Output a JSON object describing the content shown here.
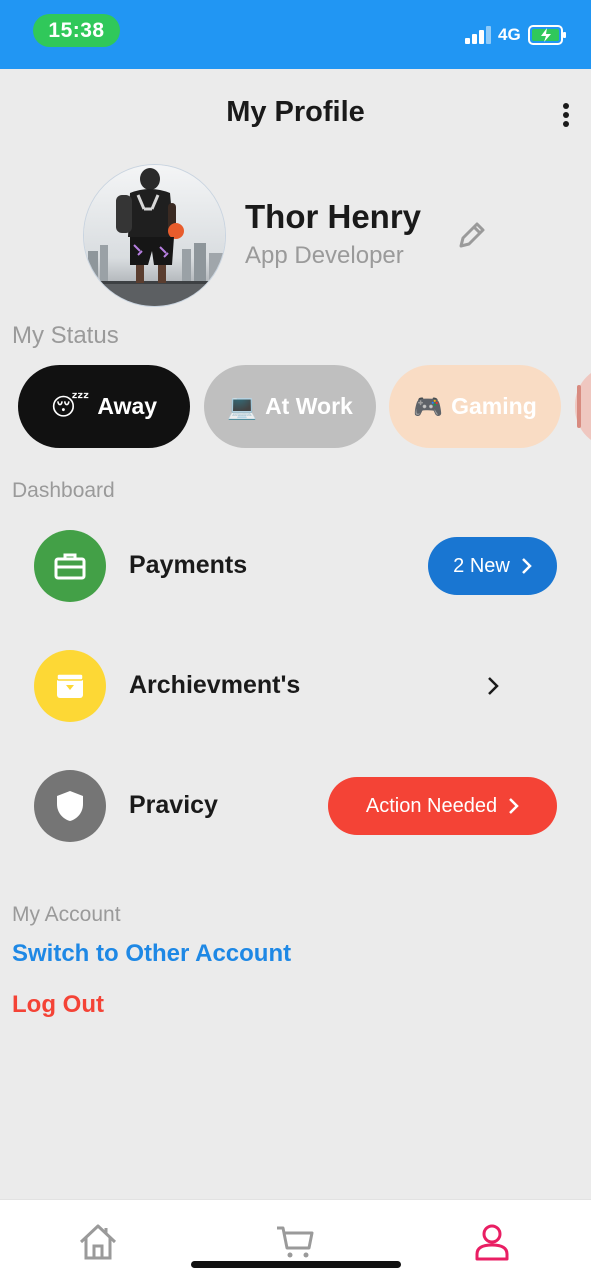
{
  "status_bar": {
    "time": "15:38",
    "network": "4G",
    "bar_color": "#2196f3",
    "time_pill_color": "#30c85a"
  },
  "header": {
    "title": "My Profile",
    "more_icon": "more-vertical-icon"
  },
  "profile": {
    "name": "Thor Henry",
    "role": "App Developer",
    "edit_icon": "pencil-icon"
  },
  "status_section": {
    "label": "My Status",
    "chips": [
      {
        "emoji": "😴",
        "label": "Away",
        "selected": true
      },
      {
        "emoji": "💻",
        "label": "At Work",
        "selected": false
      },
      {
        "emoji": "🎮",
        "label": "Gaming",
        "selected": false
      }
    ]
  },
  "dashboard": {
    "label": "Dashboard",
    "items": [
      {
        "label": "Payments",
        "icon": "briefcase-icon",
        "icon_bg": "#43a047",
        "badge": "2 New",
        "badge_color": "#1976d2"
      },
      {
        "label": "Archievment's",
        "icon": "archive-box-icon",
        "icon_bg": "#fdd835"
      },
      {
        "label": "Pravicy",
        "icon": "shield-icon",
        "icon_bg": "#757575",
        "badge": "Action Needed",
        "badge_color": "#f44336"
      }
    ]
  },
  "account": {
    "label": "My Account",
    "switch_label": "Switch to Other Account",
    "logout_label": "Log Out"
  },
  "bottom_nav": {
    "items": [
      {
        "icon": "home-icon",
        "active": false
      },
      {
        "icon": "cart-icon",
        "active": false
      },
      {
        "icon": "user-icon",
        "active": true
      }
    ],
    "active_color": "#e91e63"
  }
}
